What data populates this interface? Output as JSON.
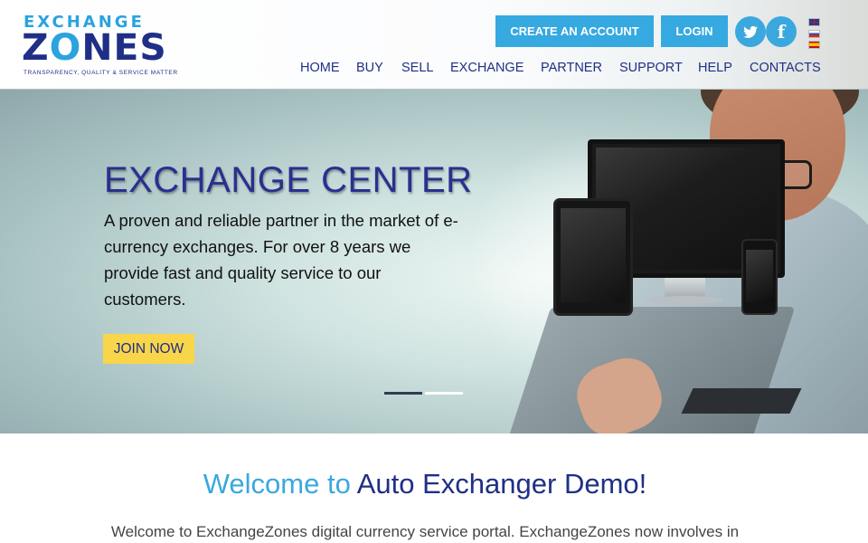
{
  "logo": {
    "top": "EXCHANGE",
    "main_pre": "Z",
    "main_o": "O",
    "main_post": "NES",
    "tagline": "TRANSPARENCY, QUALITY & SERVICE MATTER"
  },
  "header": {
    "create_account": "CREATE AN ACCOUNT",
    "login": "LOGIN",
    "social": [
      {
        "name": "twitter-icon",
        "glyph": "t"
      },
      {
        "name": "facebook-icon",
        "glyph": "f"
      }
    ],
    "languages": [
      "English",
      "Russian",
      "Spanish"
    ]
  },
  "nav": {
    "items": [
      {
        "label": "HOME"
      },
      {
        "label": "BUY"
      },
      {
        "label": "SELL"
      },
      {
        "label": "EXCHANGE"
      },
      {
        "label": "PARTNER"
      },
      {
        "label": "SUPPORT"
      },
      {
        "label": "HELP"
      },
      {
        "label": "CONTACTS"
      }
    ]
  },
  "hero": {
    "title": "EXCHANGE CENTER",
    "text": "A proven and reliable partner in the market of e-currency exchanges. For over 8 years we provide fast and quality service to our customers.",
    "join_button": "JOIN NOW",
    "slides": 2,
    "active_slide": 1
  },
  "welcome": {
    "title_a": "Welcome to",
    "title_b": "Auto Exchanger Demo!",
    "text": "Welcome to ExchangeZones digital currency service portal. ExchangeZones now involves in"
  },
  "colors": {
    "brand_blue": "#36a9e1",
    "brand_navy": "#1f2f86",
    "join_yellow": "#f9d54a"
  }
}
